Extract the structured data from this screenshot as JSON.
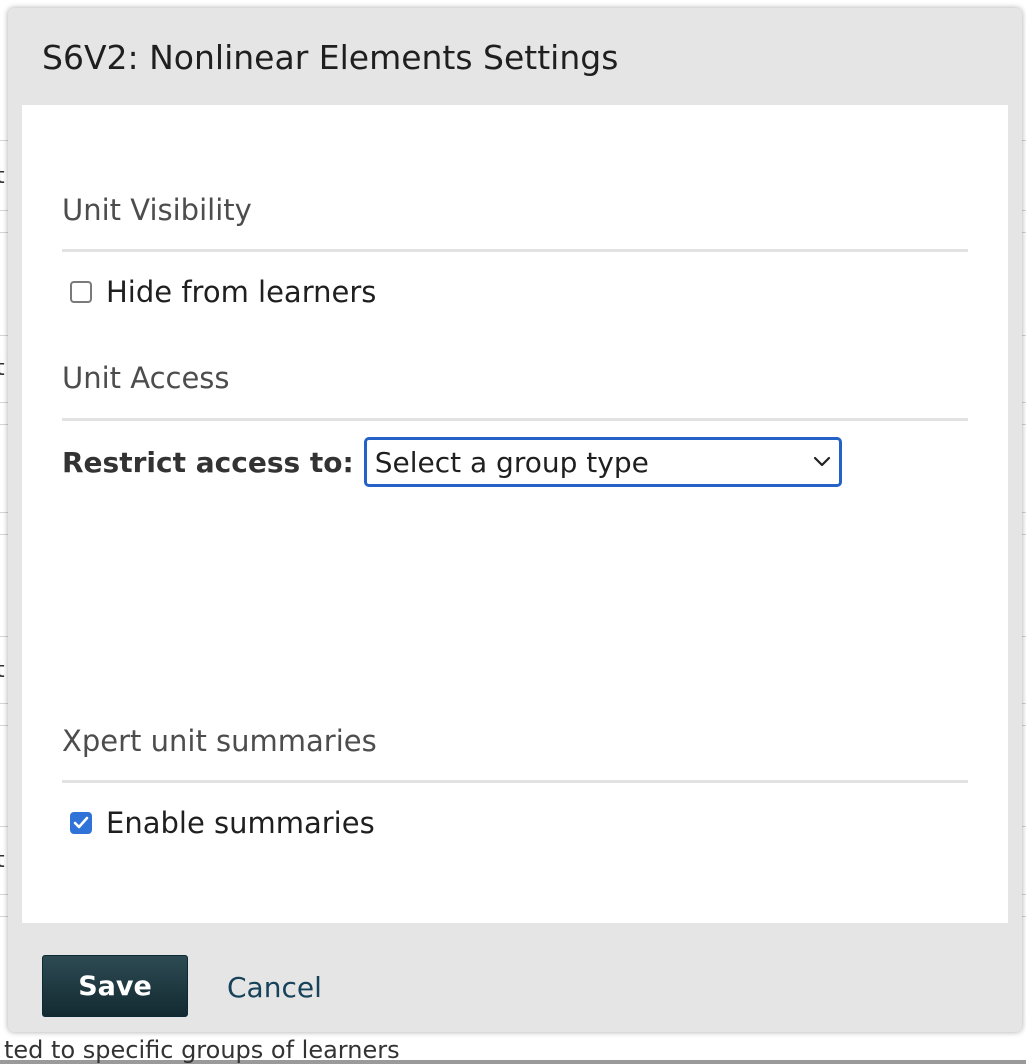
{
  "dialog": {
    "title": "S6V2: Nonlinear Elements Settings"
  },
  "sections": {
    "visibility": {
      "heading": "Unit Visibility",
      "hide_label": "Hide from learners",
      "hide_checked": false
    },
    "access": {
      "heading": "Unit Access",
      "restrict_label": "Restrict access to:",
      "group_select_value": "Select a group type"
    },
    "summaries": {
      "heading": "Xpert unit summaries",
      "enable_label": "Enable summaries",
      "enable_checked": true
    }
  },
  "footer": {
    "save_label": "Save",
    "cancel_label": "Cancel"
  },
  "background": {
    "peek_text": "ted to specific groups of learners",
    "row_peek_char": "t"
  },
  "colors": {
    "accent": "#2462c8",
    "checkbox_checked": "#2f73d8",
    "save_button": "#1d363d",
    "cancel_link": "#16425a"
  }
}
